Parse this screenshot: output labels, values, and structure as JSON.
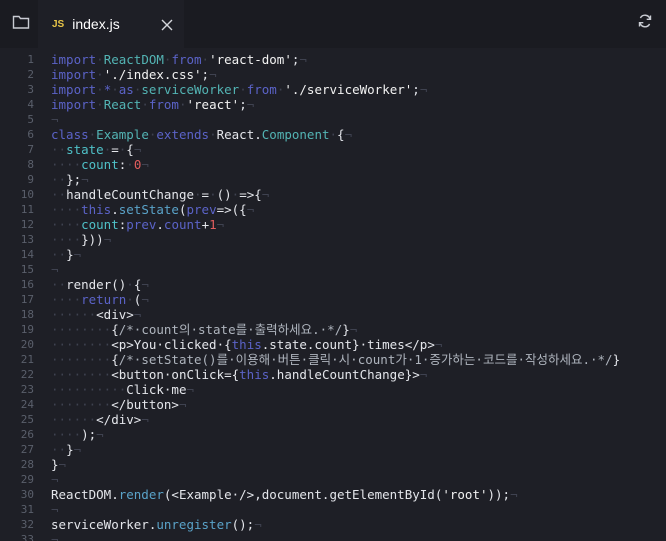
{
  "tab": {
    "lang_badge": "JS",
    "filename": "index.js"
  },
  "icons": {
    "folder": "folder-icon",
    "close": "close-icon",
    "refresh": "refresh-icon"
  },
  "lines": [
    {
      "n": "1",
      "segs": [
        [
          "kw",
          "import"
        ],
        [
          "ws",
          "·"
        ],
        [
          "cls",
          "ReactDOM"
        ],
        [
          "ws",
          "·"
        ],
        [
          "kw",
          "from"
        ],
        [
          "ws",
          "·"
        ],
        [
          "str",
          "'react-dom'"
        ],
        [
          "plain",
          ";"
        ],
        [
          "ws",
          "¬"
        ]
      ]
    },
    {
      "n": "2",
      "segs": [
        [
          "kw",
          "import"
        ],
        [
          "ws",
          "·"
        ],
        [
          "str",
          "'./index.css'"
        ],
        [
          "plain",
          ";"
        ],
        [
          "ws",
          "¬"
        ]
      ]
    },
    {
      "n": "3",
      "segs": [
        [
          "kw",
          "import"
        ],
        [
          "ws",
          "·"
        ],
        [
          "kw",
          "*"
        ],
        [
          "ws",
          "·"
        ],
        [
          "kw",
          "as"
        ],
        [
          "ws",
          "·"
        ],
        [
          "cls",
          "serviceWorker"
        ],
        [
          "ws",
          "·"
        ],
        [
          "kw",
          "from"
        ],
        [
          "ws",
          "·"
        ],
        [
          "str",
          "'./serviceWorker'"
        ],
        [
          "plain",
          ";"
        ],
        [
          "ws",
          "¬"
        ]
      ]
    },
    {
      "n": "4",
      "segs": [
        [
          "kw",
          "import"
        ],
        [
          "ws",
          "·"
        ],
        [
          "cls",
          "React"
        ],
        [
          "ws",
          "·"
        ],
        [
          "kw",
          "from"
        ],
        [
          "ws",
          "·"
        ],
        [
          "str",
          "'react'"
        ],
        [
          "plain",
          ";"
        ],
        [
          "ws",
          "¬"
        ]
      ]
    },
    {
      "n": "5",
      "segs": [
        [
          "ws",
          "¬"
        ]
      ]
    },
    {
      "n": "6",
      "segs": [
        [
          "kw",
          "class"
        ],
        [
          "ws",
          "·"
        ],
        [
          "cls",
          "Example"
        ],
        [
          "ws",
          "·"
        ],
        [
          "kw",
          "extends"
        ],
        [
          "ws",
          "·"
        ],
        [
          "plain",
          "React"
        ],
        [
          "plain",
          "."
        ],
        [
          "cls",
          "Component"
        ],
        [
          "ws",
          "·"
        ],
        [
          "plain",
          "{"
        ],
        [
          "ws",
          "¬"
        ]
      ]
    },
    {
      "n": "7",
      "segs": [
        [
          "ws",
          "··"
        ],
        [
          "var",
          "state"
        ],
        [
          "ws",
          "·"
        ],
        [
          "plain",
          "="
        ],
        [
          "ws",
          "·"
        ],
        [
          "plain",
          "{"
        ],
        [
          "ws",
          "¬"
        ]
      ]
    },
    {
      "n": "8",
      "segs": [
        [
          "ws",
          "····"
        ],
        [
          "var",
          "count"
        ],
        [
          "plain",
          ":"
        ],
        [
          "ws",
          "·"
        ],
        [
          "num",
          "0"
        ],
        [
          "ws",
          "¬"
        ]
      ]
    },
    {
      "n": "9",
      "segs": [
        [
          "ws",
          "··"
        ],
        [
          "plain",
          "};"
        ],
        [
          "ws",
          "¬"
        ]
      ]
    },
    {
      "n": "10",
      "segs": [
        [
          "ws",
          "··"
        ],
        [
          "plain",
          "handleCountChange"
        ],
        [
          "ws",
          "·"
        ],
        [
          "plain",
          "="
        ],
        [
          "ws",
          "·"
        ],
        [
          "plain",
          "()"
        ],
        [
          "ws",
          "·"
        ],
        [
          "plain",
          "=>{"
        ],
        [
          "ws",
          "¬"
        ]
      ]
    },
    {
      "n": "11",
      "segs": [
        [
          "ws",
          "····"
        ],
        [
          "kw",
          "this"
        ],
        [
          "plain",
          "."
        ],
        [
          "fn",
          "setState"
        ],
        [
          "plain",
          "("
        ],
        [
          "kw",
          "prev"
        ],
        [
          "plain",
          "=>({"
        ],
        [
          "ws",
          "¬"
        ]
      ]
    },
    {
      "n": "12",
      "segs": [
        [
          "ws",
          "····"
        ],
        [
          "var",
          "count"
        ],
        [
          "plain",
          ":"
        ],
        [
          "kw",
          "prev"
        ],
        [
          "plain",
          "."
        ],
        [
          "kw",
          "count"
        ],
        [
          "plain",
          "+"
        ],
        [
          "num",
          "1"
        ],
        [
          "ws",
          "¬"
        ]
      ]
    },
    {
      "n": "13",
      "segs": [
        [
          "ws",
          "····"
        ],
        [
          "plain",
          "}))"
        ],
        [
          "ws",
          "¬"
        ]
      ]
    },
    {
      "n": "14",
      "segs": [
        [
          "ws",
          "··"
        ],
        [
          "plain",
          "}"
        ],
        [
          "ws",
          "¬"
        ]
      ]
    },
    {
      "n": "15",
      "segs": [
        [
          "ws",
          "¬"
        ]
      ]
    },
    {
      "n": "16",
      "segs": [
        [
          "ws",
          "··"
        ],
        [
          "plain",
          "render()"
        ],
        [
          "ws",
          "·"
        ],
        [
          "plain",
          "{"
        ],
        [
          "ws",
          "¬"
        ]
      ]
    },
    {
      "n": "17",
      "segs": [
        [
          "ws",
          "····"
        ],
        [
          "kw",
          "return"
        ],
        [
          "ws",
          "·"
        ],
        [
          "plain",
          "("
        ],
        [
          "ws",
          "¬"
        ]
      ]
    },
    {
      "n": "18",
      "segs": [
        [
          "ws",
          "······"
        ],
        [
          "plain",
          "<div>"
        ],
        [
          "ws",
          "¬"
        ]
      ]
    },
    {
      "n": "19",
      "segs": [
        [
          "ws",
          "········"
        ],
        [
          "plain",
          "{"
        ],
        [
          "cmt",
          "/*·count의·state를·출력하세요.·*/"
        ],
        [
          "plain",
          "}"
        ],
        [
          "ws",
          "¬"
        ]
      ]
    },
    {
      "n": "20",
      "segs": [
        [
          "ws",
          "········"
        ],
        [
          "plain",
          "<p>You·clicked·{"
        ],
        [
          "kw",
          "this"
        ],
        [
          "plain",
          ".state.count}·times</p>"
        ],
        [
          "ws",
          "¬"
        ]
      ]
    },
    {
      "n": "21",
      "segs": [
        [
          "ws",
          "········"
        ],
        [
          "plain",
          "{"
        ],
        [
          "cmt",
          "/*·setState()를·이용해·버튼·클릭·시·count가·1·증가하는·코드를·작성하세요.·*/"
        ],
        [
          "plain",
          "}"
        ]
      ]
    },
    {
      "n": "22",
      "segs": [
        [
          "ws",
          "········"
        ],
        [
          "plain",
          "<button·onClick={"
        ],
        [
          "kw",
          "this"
        ],
        [
          "plain",
          ".handleCountChange}>"
        ],
        [
          "ws",
          "¬"
        ]
      ]
    },
    {
      "n": "23",
      "segs": [
        [
          "ws",
          "··········"
        ],
        [
          "plain",
          "Click·me"
        ],
        [
          "ws",
          "¬"
        ]
      ]
    },
    {
      "n": "24",
      "segs": [
        [
          "ws",
          "········"
        ],
        [
          "plain",
          "</button>"
        ],
        [
          "ws",
          "¬"
        ]
      ]
    },
    {
      "n": "25",
      "segs": [
        [
          "ws",
          "······"
        ],
        [
          "plain",
          "</div>"
        ],
        [
          "ws",
          "¬"
        ]
      ]
    },
    {
      "n": "26",
      "segs": [
        [
          "ws",
          "····"
        ],
        [
          "plain",
          ");"
        ],
        [
          "ws",
          "¬"
        ]
      ]
    },
    {
      "n": "27",
      "segs": [
        [
          "ws",
          "··"
        ],
        [
          "plain",
          "}"
        ],
        [
          "ws",
          "¬"
        ]
      ]
    },
    {
      "n": "28",
      "segs": [
        [
          "plain",
          "}"
        ],
        [
          "ws",
          "¬"
        ]
      ]
    },
    {
      "n": "29",
      "segs": [
        [
          "ws",
          "¬"
        ]
      ]
    },
    {
      "n": "30",
      "segs": [
        [
          "plain",
          "ReactDOM."
        ],
        [
          "fn",
          "render"
        ],
        [
          "plain",
          "(<Example·/>,document.getElementById("
        ],
        [
          "str",
          "'root'"
        ],
        [
          "plain",
          "));"
        ],
        [
          "ws",
          "¬"
        ]
      ]
    },
    {
      "n": "31",
      "segs": [
        [
          "ws",
          "¬"
        ]
      ]
    },
    {
      "n": "32",
      "segs": [
        [
          "plain",
          "serviceWorker."
        ],
        [
          "fn",
          "unregister"
        ],
        [
          "plain",
          "();"
        ],
        [
          "ws",
          "¬"
        ]
      ]
    },
    {
      "n": "33",
      "segs": [
        [
          "ws",
          "¬"
        ]
      ]
    }
  ]
}
